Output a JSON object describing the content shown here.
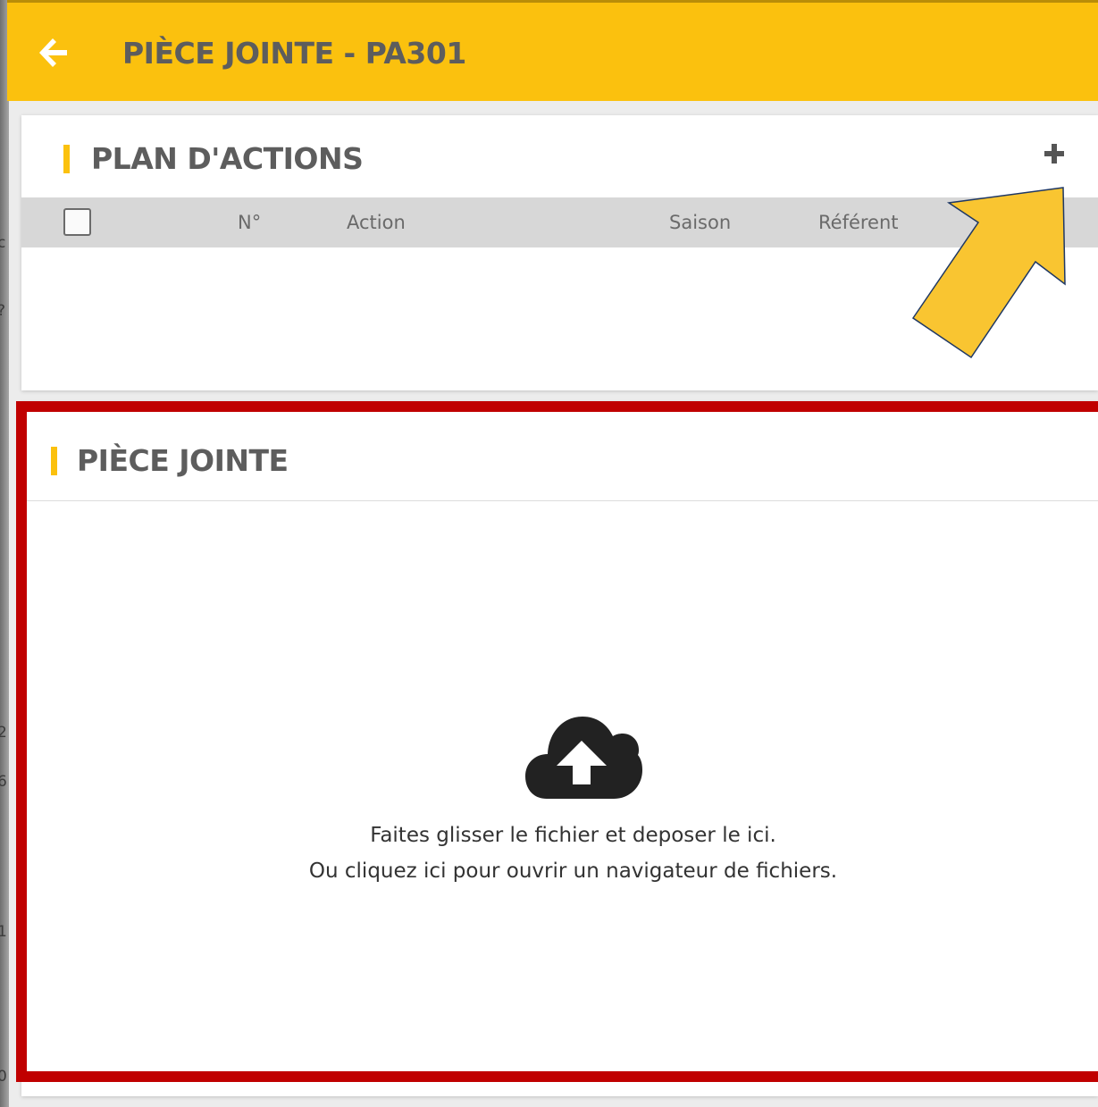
{
  "header": {
    "title": "PIÈCE JOINTE - PA301",
    "back_icon": "arrow-left-icon"
  },
  "plan_actions": {
    "title": "PLAN D'ACTIONS",
    "add_icon": "plus-icon",
    "columns": [
      "N°",
      "Action",
      "Saison",
      "Référent"
    ],
    "rows": []
  },
  "attachment": {
    "title": "PIÈCE JOINTE",
    "upload_icon": "cloud-upload-icon",
    "line1": "Faites glisser le fichier et deposer le ici.",
    "line2": "Ou cliquez ici pour ouvrir un navigateur de fichiers."
  },
  "colors": {
    "accent": "#fbc10e",
    "highlight_frame": "#c00000",
    "annotation_arrow": "#f9c531"
  }
}
